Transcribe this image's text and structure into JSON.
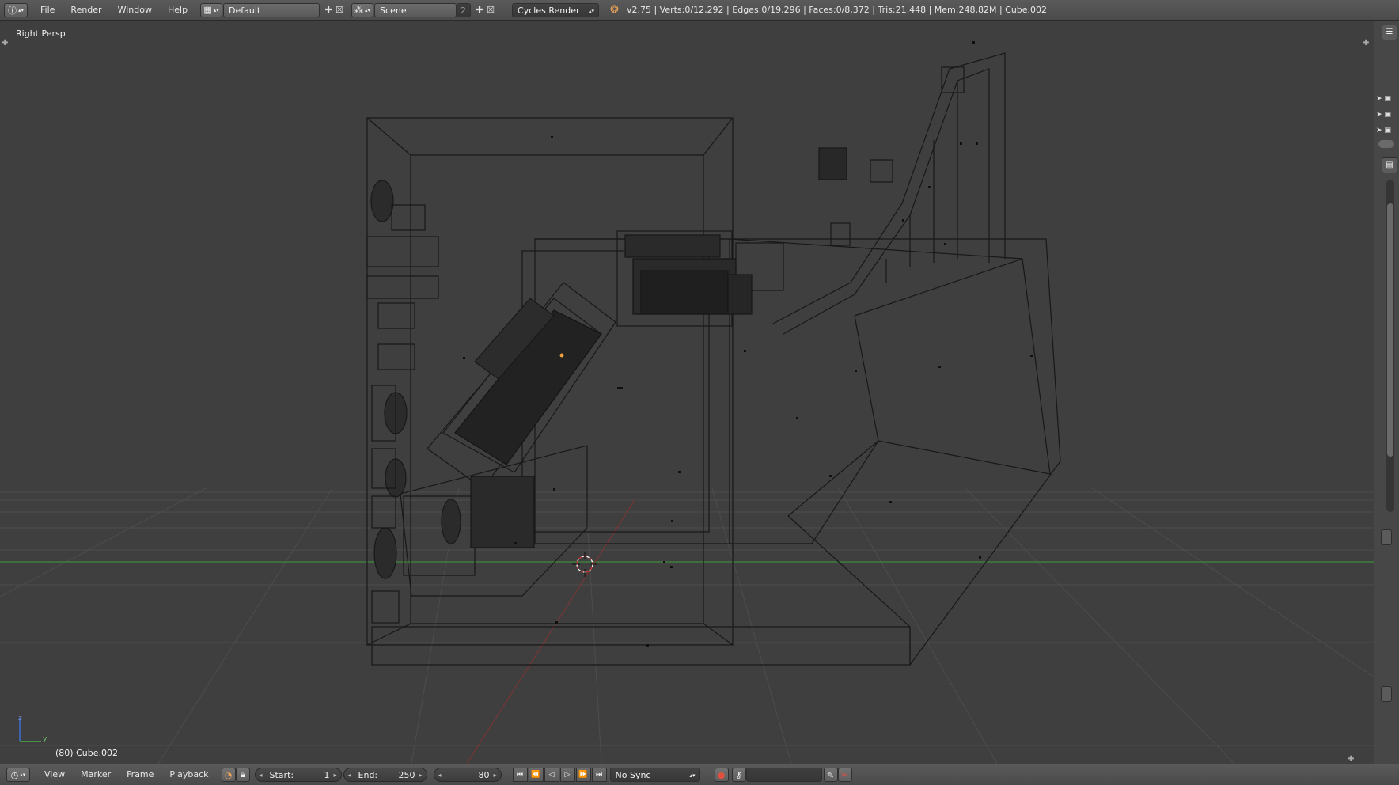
{
  "topbar": {
    "info_icon": "info-icon",
    "menus": [
      "File",
      "Render",
      "Window",
      "Help"
    ],
    "layout_name": "Default",
    "scene_name": "Scene",
    "scene_users": "2",
    "render_engine": "Cycles Render",
    "stats": "v2.75 | Verts:0/12,292 | Edges:0/19,296 | Faces:0/8,372 | Tris:21,448 | Mem:248.82M | Cube.002"
  },
  "viewport": {
    "view_name": "Right Persp",
    "object_info": "(80) Cube.002",
    "axis_z": "z",
    "axis_y": "y"
  },
  "timeline": {
    "editor_icon": "clock-icon",
    "menus": [
      "View",
      "Marker",
      "Frame",
      "Playback"
    ],
    "start_label": "Start:",
    "start_value": "1",
    "end_label": "End:",
    "end_value": "250",
    "current_frame": "80",
    "sync_mode": "No Sync"
  },
  "colors": {
    "background": "#3f3f3f",
    "grid": "#4c4c4c",
    "y_axis": "#3e8a3e",
    "x_axis": "#8a3a3a",
    "wire": "#1a1a1a"
  }
}
